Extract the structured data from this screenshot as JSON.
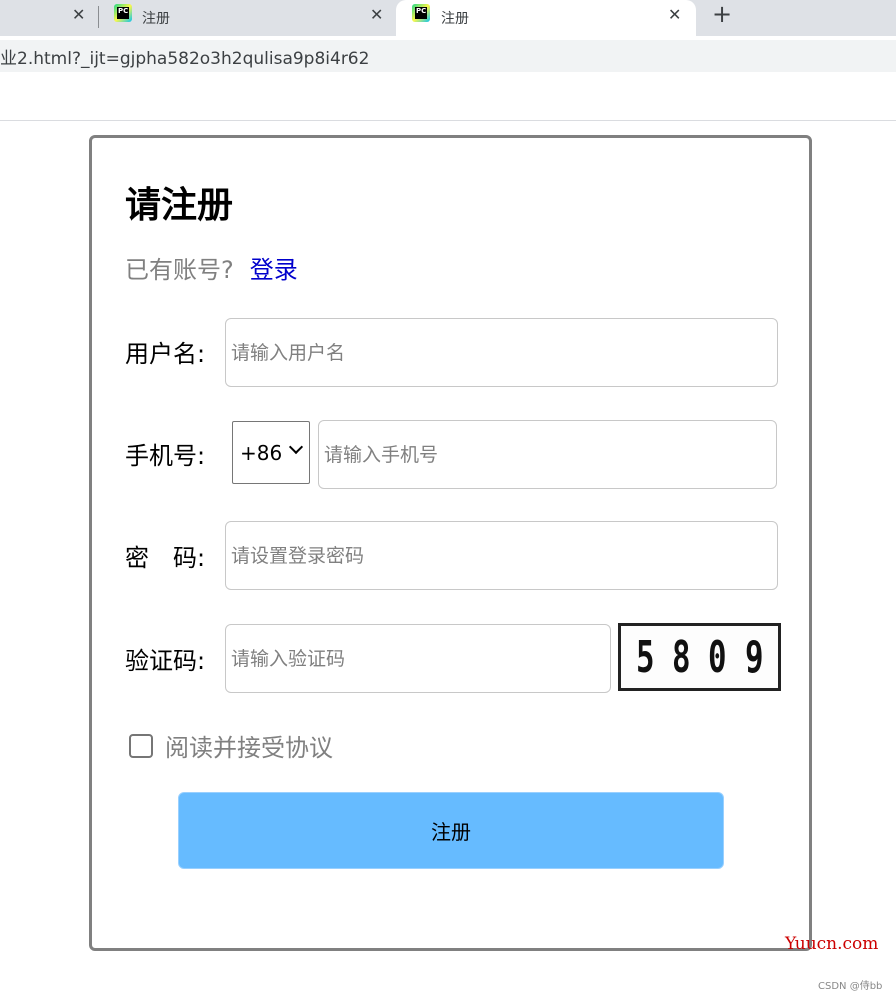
{
  "browser": {
    "tabs": [
      {
        "title": "",
        "active": false
      },
      {
        "title": "注册",
        "active": false
      },
      {
        "title": "注册",
        "active": true
      }
    ],
    "close_glyph": "✕",
    "new_tab_glyph": "+",
    "tab_icon_text": "PC",
    "url": "业2.html?_ijt=gjpha582o3h2qulisa9p8i4r62"
  },
  "form": {
    "title": "请注册",
    "have_account": "已有账号?",
    "login_link": "登录",
    "username_label": "用户名:",
    "username_placeholder": "请输入用户名",
    "phone_label": "手机号:",
    "country_code": "+86",
    "phone_placeholder": "请输入手机号",
    "password_label": "密　码:",
    "password_placeholder": "请设置登录密码",
    "captcha_label": "验证码:",
    "captcha_placeholder": "请输入验证码",
    "captcha_digits": [
      "5",
      "8",
      "0",
      "9"
    ],
    "agree_text": "阅读并接受协议",
    "submit_label": "注册"
  },
  "watermarks": {
    "site": "Yuucn.com",
    "csdn": "CSDN @侍bb"
  },
  "colors": {
    "submit_bg": "#66bbff",
    "link": "#0000cc",
    "card_border": "#808080"
  }
}
